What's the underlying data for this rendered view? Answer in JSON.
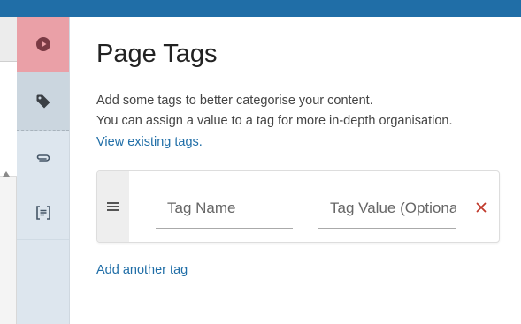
{
  "toolbox": {
    "items": [
      {
        "name": "play",
        "icon": "play-circle-icon"
      },
      {
        "name": "tags",
        "icon": "tag-icon",
        "active": true
      },
      {
        "name": "attachments",
        "icon": "paperclip-icon"
      },
      {
        "name": "templates",
        "icon": "template-icon"
      }
    ]
  },
  "main": {
    "title": "Page Tags",
    "description_line1": "Add some tags to better categorise your content.",
    "description_line2": "You can assign a value to a tag for more in-depth organisation.",
    "view_tags_link": "View existing tags.",
    "tag_rows": [
      {
        "name_placeholder": "Tag Name",
        "value_placeholder": "Tag Value (Optional)",
        "name_value": "",
        "value_value": ""
      }
    ],
    "add_tag_link": "Add another tag"
  },
  "colors": {
    "topbar": "#206ea7",
    "link": "#206ea7",
    "remove": "#c0392b",
    "active_tool": "#eaa0a7"
  }
}
